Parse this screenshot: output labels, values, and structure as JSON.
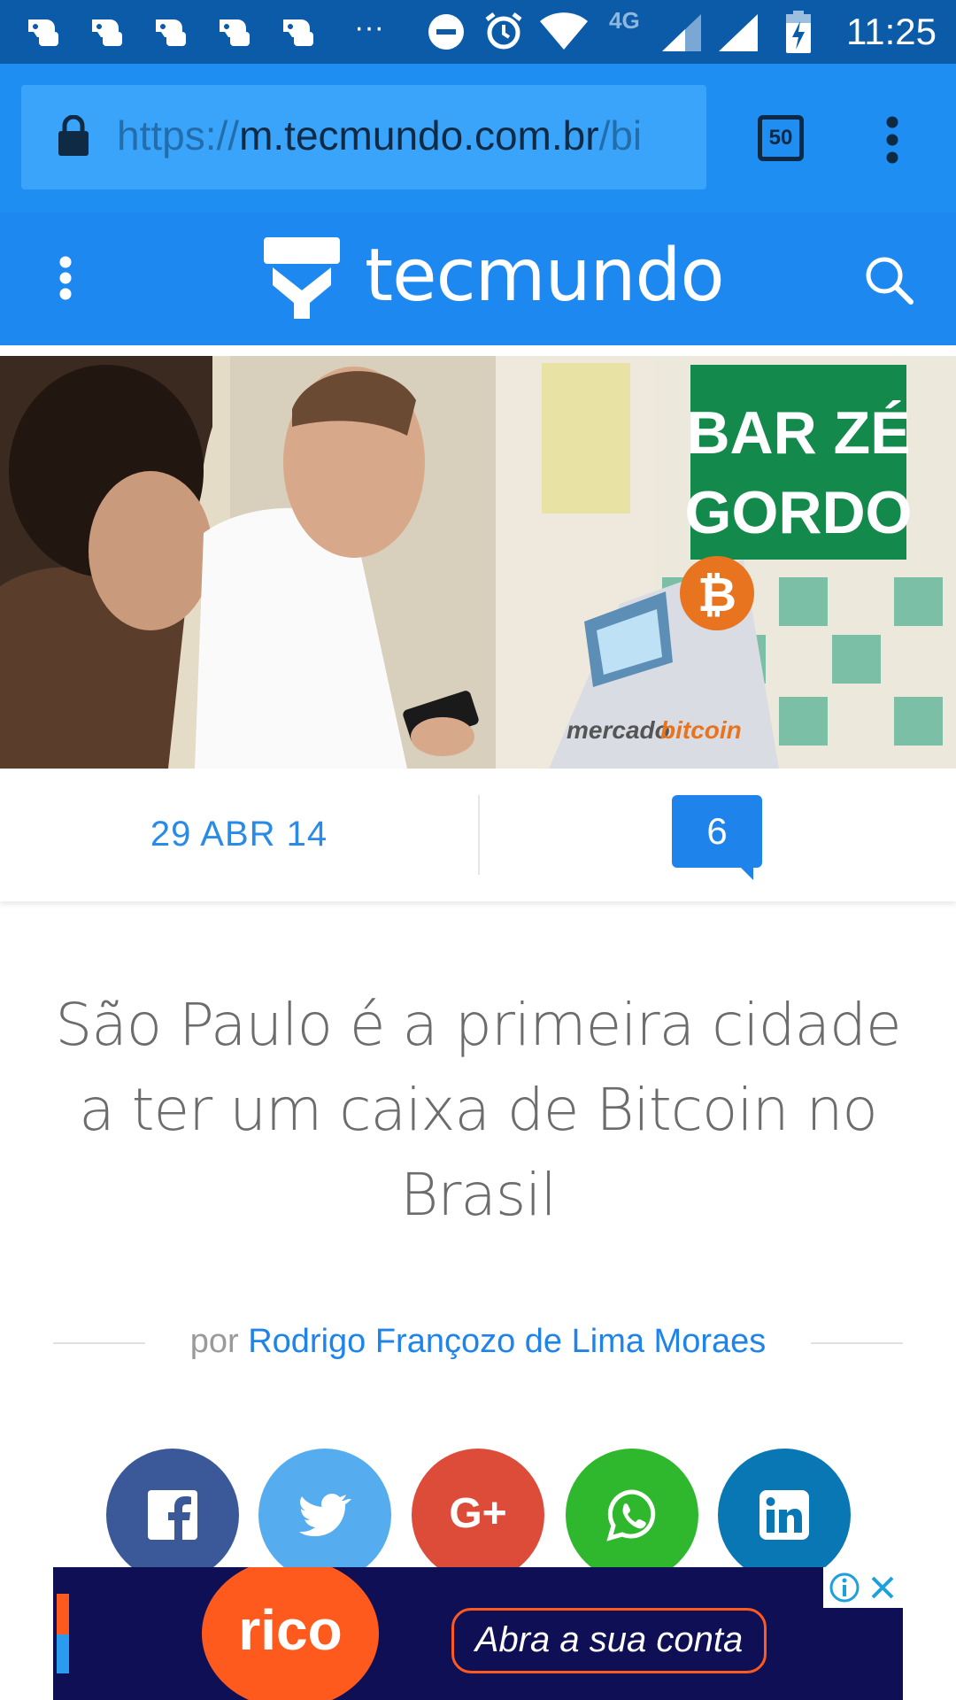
{
  "status_bar": {
    "time": "11:25",
    "network": "4G",
    "notification_icons": [
      "game-controller-icon",
      "game-controller-icon",
      "game-controller-icon",
      "game-controller-icon",
      "game-controller-icon"
    ],
    "more_indicator": "···"
  },
  "browser": {
    "url_scheme": "https://",
    "url_host": "m.tecmundo.com.br",
    "url_path": "/bi",
    "tab_count": "50"
  },
  "site": {
    "name": "tecmundo"
  },
  "article": {
    "date": "29 ABR 14",
    "comment_count": "6",
    "title": "São Paulo é a primeira cidade a ter um caixa de Bitcoin no Brasil",
    "byline_prefix": "por",
    "author": "Rodrigo Françozo de Lima Moraes",
    "hero_sign_line1": "BAR ZÉ",
    "hero_sign_line2": "GORDO",
    "hero_atm_brand_a": "mercado",
    "hero_atm_brand_b": "bitcoin"
  },
  "share": {
    "buttons": [
      {
        "name": "facebook",
        "icon": "facebook-icon",
        "color": "#3b5998"
      },
      {
        "name": "twitter",
        "icon": "twitter-icon",
        "color": "#55acee"
      },
      {
        "name": "google-plus",
        "icon": "google-plus-icon",
        "color": "#dd4b39"
      },
      {
        "name": "whatsapp",
        "icon": "whatsapp-icon",
        "color": "#2fb82d"
      },
      {
        "name": "linkedin",
        "icon": "linkedin-icon",
        "color": "#0a77b5"
      }
    ],
    "gplus_text": "G+"
  },
  "ad": {
    "brand": "rico",
    "cta": "Abra a sua conta"
  },
  "colors": {
    "status_bar": "#0b5ba8",
    "url_bar": "#1f8ef2",
    "site_header": "#1d89f0",
    "accent": "#1e84ec"
  }
}
